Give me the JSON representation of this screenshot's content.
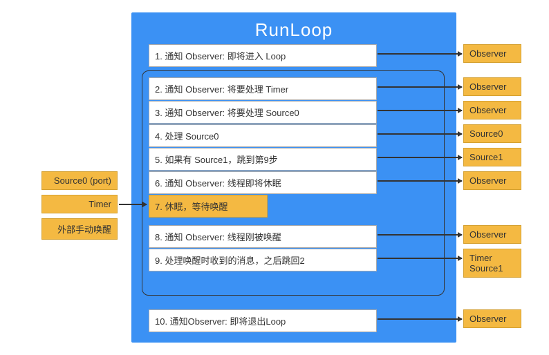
{
  "title": "RunLoop",
  "steps": {
    "s1": "1. 通知 Observer: 即将进入 Loop",
    "s2": "2. 通知 Observer: 将要处理 Timer",
    "s3": "3. 通知 Observer: 将要处理 Source0",
    "s4": "4. 处理 Source0",
    "s5": "5. 如果有 Source1，跳到第9步",
    "s6": "6. 通知 Observer: 线程即将休眠",
    "s7": "7. 休眠，等待唤醒",
    "s8": "8. 通知 Observer: 线程刚被唤醒",
    "s9": "9. 处理唤醒时收到的消息，之后跳回2",
    "s10": "10. 通知Observer: 即将退出Loop"
  },
  "left": {
    "source0": "Source0 (port)",
    "timer": "Timer",
    "wake": "外部手动唤醒"
  },
  "right": {
    "observer": "Observer",
    "source0": "Source0",
    "source1": "Source1",
    "timersrc": "Timer\nSource1"
  },
  "colors": {
    "blue": "#3b91f4",
    "yellow": "#f4b942"
  }
}
